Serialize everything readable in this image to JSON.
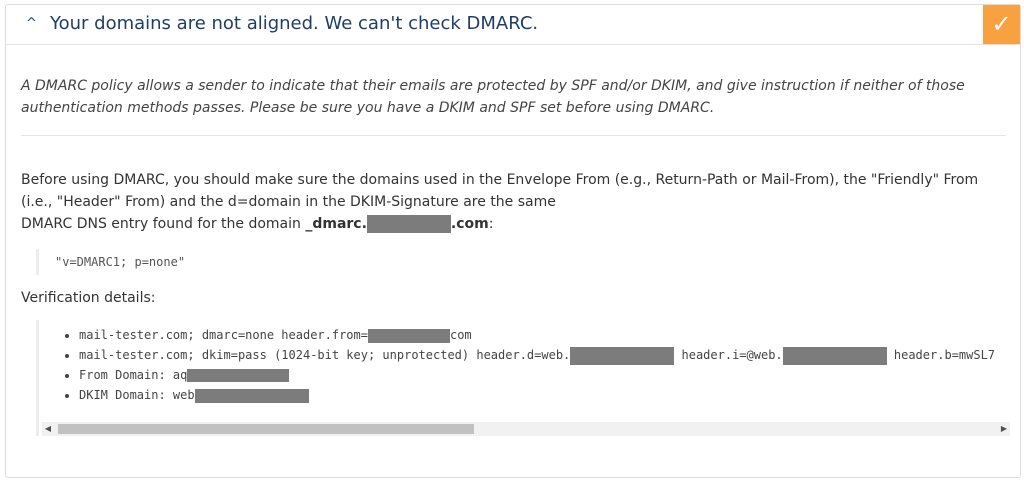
{
  "header": {
    "title": "Your domains are not aligned. We can't check DMARC.",
    "status_icon": "checkmark-icon",
    "status_color": "#f7a140"
  },
  "intro_text": "A DMARC policy allows a sender to indicate that their emails are protected by SPF and/or DKIM, and give instruction if neither of those authentication methods passes. Please be sure you have a DKIM and SPF set before using DMARC.",
  "alignment_text": "Before using DMARC, you should make sure the domains used in the Envelope From (e.g., Return-Path or Mail-From), the \"Friendly\" From (i.e., \"Header\" From) and the d=domain in the DKIM-Signature are the same",
  "dns_entry": {
    "label": "DMARC DNS entry found for the domain",
    "domain_prefix": "_dmarc.",
    "domain_suffix": ".com",
    "colon": ":",
    "record": "\"v=DMARC1; p=none\""
  },
  "verification": {
    "heading": "Verification details:",
    "lines": {
      "l1_a": "mail-tester.com; dmarc=none header.from=",
      "l1_b": "com",
      "l2_a": "mail-tester.com; dkim=pass (1024-bit key; unprotected) header.d=web.",
      "l2_b": " header.i=@web.",
      "l2_c": " header.b=mwSL7",
      "l3_a": "From Domain: aq",
      "l4_a": "DKIM Domain: web"
    }
  },
  "scrollbar": {
    "left_arrow": "◀",
    "right_arrow": "▶"
  }
}
